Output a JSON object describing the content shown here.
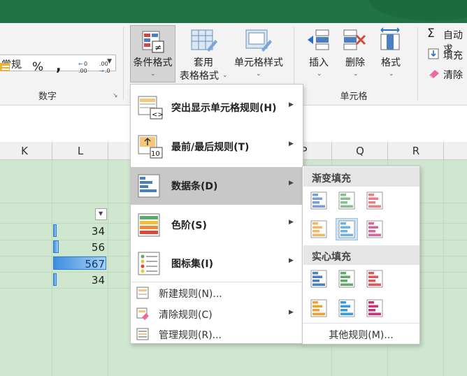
{
  "ribbon": {
    "number_format": "常规",
    "percent_symbol": "%",
    "comma_symbol": ",",
    "group_number": "数字",
    "conditional_format": "条件格式",
    "format_as_table_line1": "套用",
    "format_as_table_line2": "表格格式",
    "cell_styles": "单元格样式",
    "insert": "插入",
    "delete": "删除",
    "format": "格式",
    "group_cells": "单元格",
    "autosum": "自动求",
    "fill": "填充",
    "clear": "清除"
  },
  "columns": [
    "K",
    "L",
    "P",
    "Q",
    "R"
  ],
  "cells": [
    "34",
    "56",
    "567",
    "34"
  ],
  "databar_fraction": [
    0.06,
    0.1,
    1.0,
    0.06
  ],
  "menu": {
    "items": [
      {
        "label": "突出显示单元格规则(H)"
      },
      {
        "label": "最前/最后规则(T)"
      },
      {
        "label": "数据条(D)"
      },
      {
        "label": "色阶(S)"
      },
      {
        "label": "图标集(I)"
      }
    ],
    "new_rule": "新建规则(N)...",
    "clear_rules": "清除规则(C)",
    "manage_rules": "管理规则(R)..."
  },
  "submenu": {
    "gradient_fill": "渐变填充",
    "solid_fill": "实心填充",
    "other_rules": "其他规则(M)...",
    "bar_colors": [
      "#4a7fc1",
      "#5cab6a",
      "#e0555a",
      "#f0a030",
      "#3b9ad9",
      "#c8327d"
    ]
  },
  "colors": {
    "titlebar": "#217346",
    "sheet_bg": "#cfe6cf",
    "menu_selected": "#c8c8c8"
  }
}
